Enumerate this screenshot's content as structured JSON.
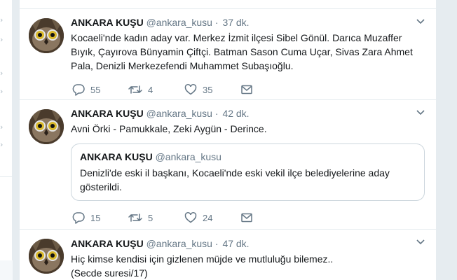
{
  "tweets": [
    {
      "name": "ANKARA KUŞU",
      "handle": "@ankara_kusu",
      "separator": "·",
      "time": "37 dk.",
      "text": "Kocaeli'nde kadın aday var. Merkez İzmit ilçesi Sibel Gönül. Darıca Muzaffer Bıyık, Çayırova Bünyamin Çiftçi. Batman Sason Cuma Uçar, Sivas Zara Ahmet Pala, Denizli Merkezefendi Muhammet Subaşıoğlu.",
      "replies": "55",
      "retweets": "4",
      "likes": "35"
    },
    {
      "name": "ANKARA KUŞU",
      "handle": "@ankara_kusu",
      "separator": "·",
      "time": "42 dk.",
      "text": "Avni Örki - Pamukkale, Zeki Aygün - Derince.",
      "quote": {
        "name": "ANKARA KUŞU",
        "handle": "@ankara_kusu",
        "text": "Denizli'de eski il başkanı, Kocaeli'nde eski vekil ilçe belediyelerine aday gösterildi."
      },
      "replies": "15",
      "retweets": "5",
      "likes": "24"
    },
    {
      "name": "ANKARA KUŞU",
      "handle": "@ankara_kusu",
      "separator": "·",
      "time": "47 dk.",
      "text_lines": [
        "Hiç kimse kendisi için gizlenen müjde ve mutluluğu bilemez..",
        "(Secde suresi/17)"
      ]
    }
  ],
  "icons": {
    "avatar": "owl-avatar",
    "caret": "chevron-down-icon",
    "reply": "reply-icon",
    "retweet": "retweet-icon",
    "like": "heart-icon",
    "dm": "envelope-icon"
  },
  "colors": {
    "text": "#14171a",
    "secondary": "#657786",
    "border": "#e6ecf0",
    "background": "#e6ecf0"
  }
}
